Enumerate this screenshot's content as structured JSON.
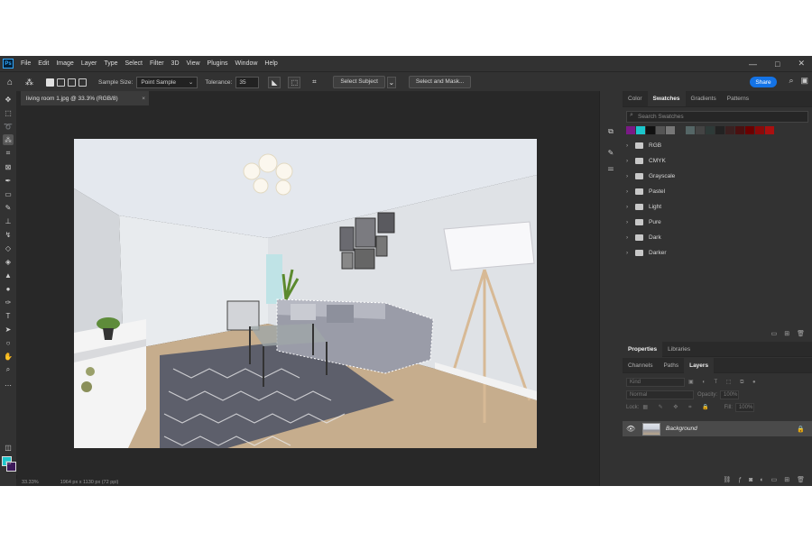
{
  "app": {
    "logo": "Ps",
    "menu": [
      "File",
      "Edit",
      "Image",
      "Layer",
      "Type",
      "Select",
      "Filter",
      "3D",
      "View",
      "Plugins",
      "Window",
      "Help"
    ],
    "window_controls": {
      "minimize": "—",
      "maximize": "□",
      "close": "✕"
    }
  },
  "options": {
    "sample_size_label": "Sample Size:",
    "sample_size_value": "Point Sample",
    "tolerance_label": "Tolerance:",
    "tolerance_value": "35",
    "select_subject": "Select Subject",
    "select_and_mask": "Select and Mask...",
    "share": "Share"
  },
  "document": {
    "tab_title": "living room 1.jpg @ 33.3% (RGB/8)",
    "close_glyph": "×",
    "zoom": "33.33%",
    "info": "1964 px x 1130 px (72 ppi)"
  },
  "colors": {
    "foreground": "#1cc6cc",
    "background": "#3d1a5a",
    "accent": "#1473e6"
  },
  "swatches_panel": {
    "tabs": [
      "Color",
      "Swatches",
      "Gradients",
      "Patterns"
    ],
    "active_tab": "Swatches",
    "search_placeholder": "Search Swatches",
    "recent": [
      "#7a1a86",
      "#1cc6cc",
      "#111111",
      "#555555",
      "#777777",
      "#333333",
      "#556666",
      "#444444",
      "#2e3a38",
      "#222222",
      "#3a2020",
      "#4a1010",
      "#6a0000",
      "#8a0a0a",
      "#aa1010"
    ],
    "groups": [
      "RGB",
      "CMYK",
      "Grayscale",
      "Pastel",
      "Light",
      "Pure",
      "Dark",
      "Darker"
    ]
  },
  "properties_panel": {
    "tabs": [
      "Properties",
      "Libraries"
    ]
  },
  "layers_panel": {
    "tabs": [
      "Channels",
      "Paths",
      "Layers"
    ],
    "active_tab": "Layers",
    "kind_label": "Kind",
    "blend_mode": "Normal",
    "opacity_label": "Opacity:",
    "opacity_value": "100%",
    "lock_label": "Lock:",
    "fill_label": "Fill:",
    "fill_value": "100%",
    "layers": [
      {
        "name": "Background",
        "visible": true,
        "locked": true
      }
    ]
  }
}
